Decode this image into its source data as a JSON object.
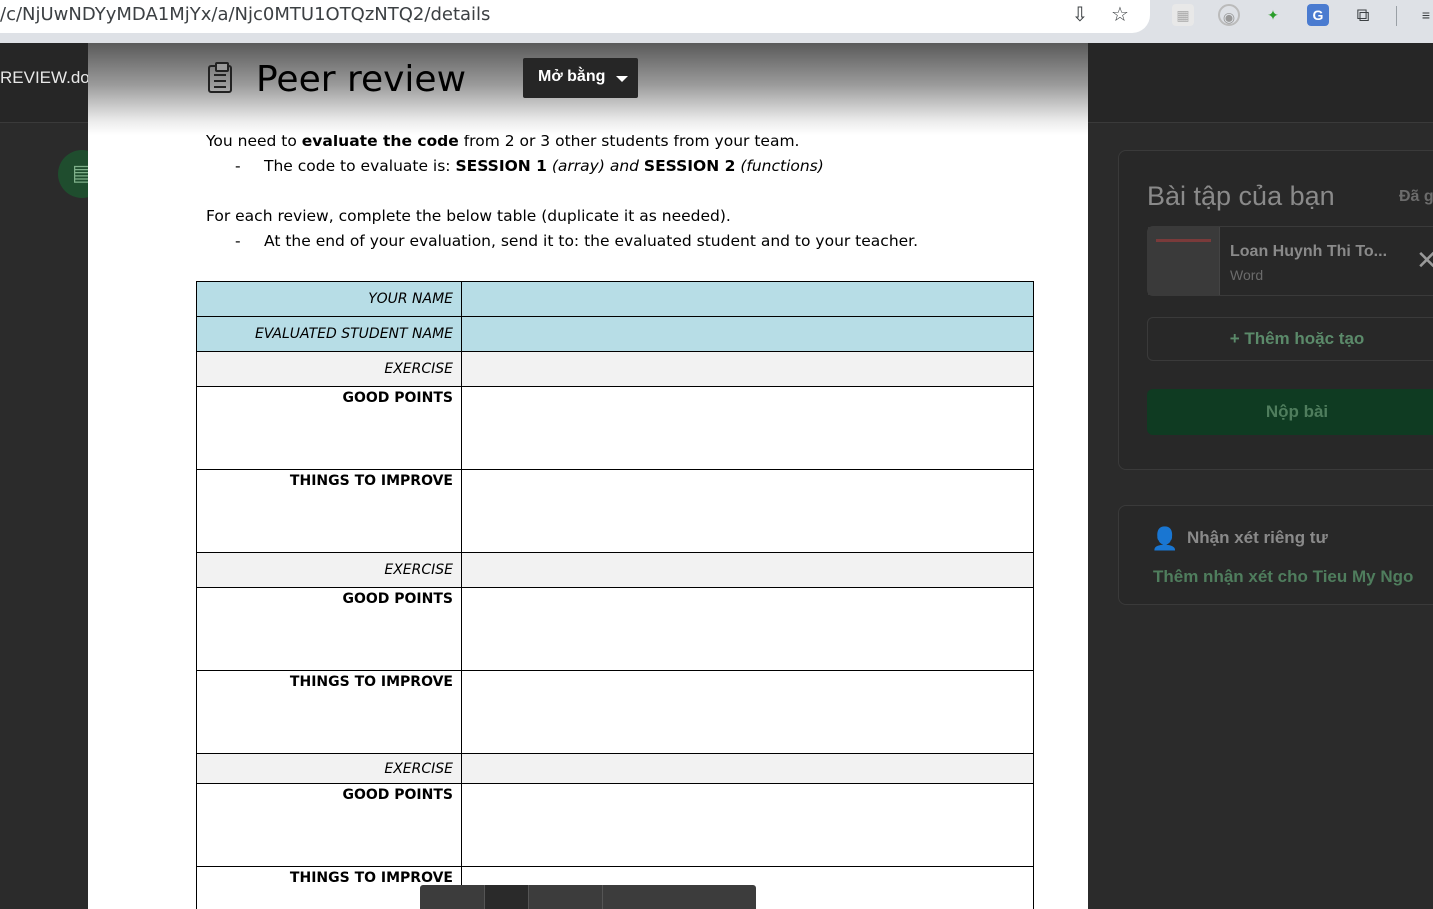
{
  "browser": {
    "url": "/c/NjUwNDYyMDA1MjYx/a/Njc0MTU1OTQzNTQ2/details"
  },
  "background": {
    "filename": "REVIEW.docx",
    "assignment_panel": {
      "title": "Bài tập của bạn",
      "status": "Đã g",
      "attachment_name": "Loan Huynh Thi To...",
      "attachment_type": "Word",
      "add_label": "+ Thêm hoặc tạo",
      "submit_label": "Nộp bài"
    },
    "private_comment": {
      "title": "Nhận xét riêng tư",
      "link": "Thêm nhận xét cho Tieu My Ngo"
    }
  },
  "viewer": {
    "title": "Peer review",
    "open_with": "Mở bằng"
  },
  "document": {
    "line1_a": "You need to ",
    "line1_b": "evaluate the code",
    "line1_c": " from 2 or 3 other students from your team.",
    "bullet1_a": "The code to evaluate is: ",
    "bullet1_b": "SESSION 1",
    "bullet1_c": " (array) and ",
    "bullet1_d": "SESSION 2",
    "bullet1_e": " (functions)",
    "line2": "For each review, complete the below table (duplicate it as needed).",
    "bullet2": "At the end of your evaluation, send it to: the evaluated student and to your teacher.",
    "dash": "-",
    "table": {
      "your_name": "YOUR NAME",
      "evaluated_student": "EVALUATED STUDENT NAME",
      "exercise": "EXERCISE",
      "good_points": "GOOD POINTS",
      "things_to_improve": "THINGS TO IMPROVE"
    }
  },
  "colors": {
    "header_row": "#b7dde6",
    "exercise_row": "#f2f2f2",
    "submit_button": "#0f3b22"
  }
}
